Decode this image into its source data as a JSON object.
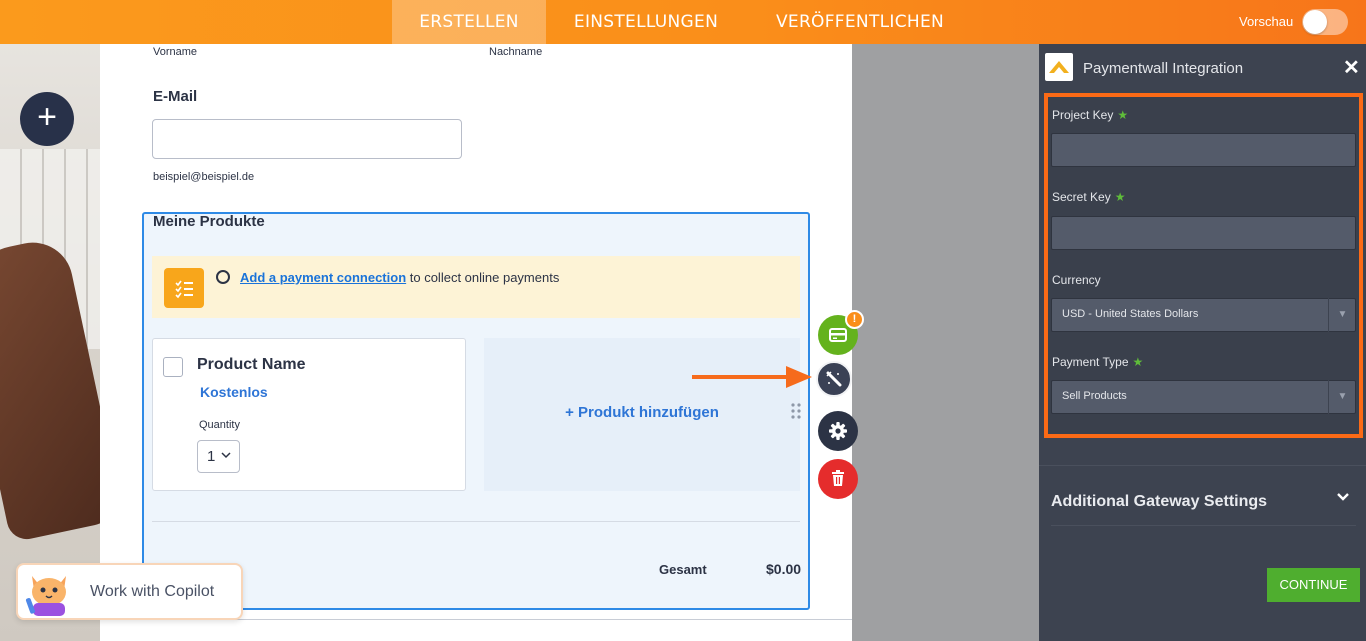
{
  "topbar": {
    "tabs": [
      {
        "label": "ERSTELLEN",
        "active": true
      },
      {
        "label": "EINSTELLUNGEN",
        "active": false
      },
      {
        "label": "VERÖFFENTLICHEN",
        "active": false
      }
    ],
    "preview_label": "Vorschau",
    "preview_on": false,
    "colors": {
      "bar": "#fa8e1a"
    }
  },
  "form": {
    "first_name_sublabel": "Vorname",
    "last_name_sublabel": "Nachname",
    "email_label": "E-Mail",
    "email_value": "",
    "email_sublabel": "beispiel@beispiel.de",
    "products": {
      "title": "Meine Produkte",
      "notice_link": "Add a payment connection",
      "notice_text": " to collect online payments",
      "product_name": "Product Name",
      "product_price": "Kostenlos",
      "quantity_label": "Quantity",
      "quantity_value": "1",
      "add_product": "+ Produkt hinzufügen",
      "total_label": "Gesamt",
      "total_value": "$0.00"
    }
  },
  "toolbar": {
    "badge": "!",
    "icons": [
      "credit-card-icon",
      "magic-wand-icon",
      "gear-icon",
      "trash-icon"
    ]
  },
  "copilot": {
    "label": "Work with Copilot"
  },
  "panel": {
    "title": "Paymentwall Integration",
    "close": "✕",
    "project_key_label": "Project Key",
    "project_key_value": "",
    "secret_key_label": "Secret Key",
    "secret_key_value": "",
    "currency_label": "Currency",
    "currency_value": "USD - United States Dollars",
    "payment_type_label": "Payment Type",
    "payment_type_value": "Sell Products",
    "required_star": "★",
    "additional_label": "Additional Gateway Settings",
    "continue_label": "CONTINUE",
    "colors": {
      "highlight_border": "#fb6a16",
      "continue": "#4fae2f"
    }
  }
}
